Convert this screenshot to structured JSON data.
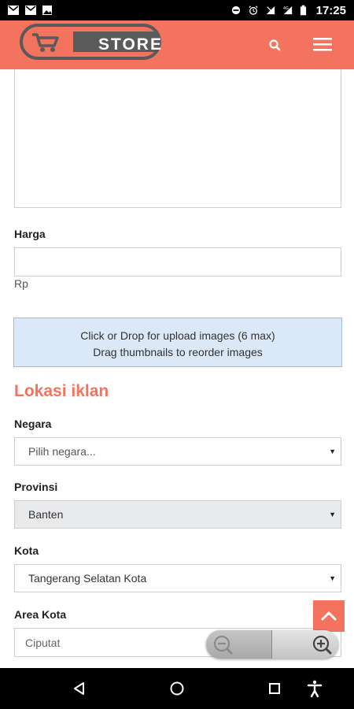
{
  "status_bar": {
    "time": "17:25",
    "left_icons": [
      "gmail-icon",
      "gmail-icon",
      "image-icon"
    ],
    "right_icons": [
      "do-not-disturb-icon",
      "alarm-icon",
      "signal-icon",
      "4g-signal-icon",
      "battery-icon"
    ]
  },
  "header": {
    "logo_text": "STORE",
    "brand_color": "#F4735E",
    "search_icon": "search-icon",
    "menu_icon": "hamburger-menu-icon"
  },
  "form": {
    "description_value": "",
    "price": {
      "label": "Harga",
      "value": "",
      "currency_hint": "Rp"
    },
    "upload": {
      "line1": "Click or Drop for upload images (6 max)",
      "line2": "Drag thumbnails to reorder images"
    },
    "location": {
      "section_title": "Lokasi iklan",
      "country": {
        "label": "Negara",
        "selected": "Pilih negara..."
      },
      "province": {
        "label": "Provinsi",
        "selected": "Banten"
      },
      "city": {
        "label": "Kota",
        "selected": "Tangerang Selatan Kota"
      },
      "city_area": {
        "label": "Area Kota",
        "placeholder": "Ciputat"
      }
    }
  },
  "floating": {
    "scroll_top_icon": "chevron-up-icon",
    "zoom_out_icon": "zoom-out-icon",
    "zoom_in_icon": "zoom-in-icon"
  },
  "nav_bar": {
    "back_icon": "back-triangle-icon",
    "home_icon": "home-circle-icon",
    "recents_icon": "recents-square-icon",
    "accessibility_icon": "accessibility-icon"
  }
}
